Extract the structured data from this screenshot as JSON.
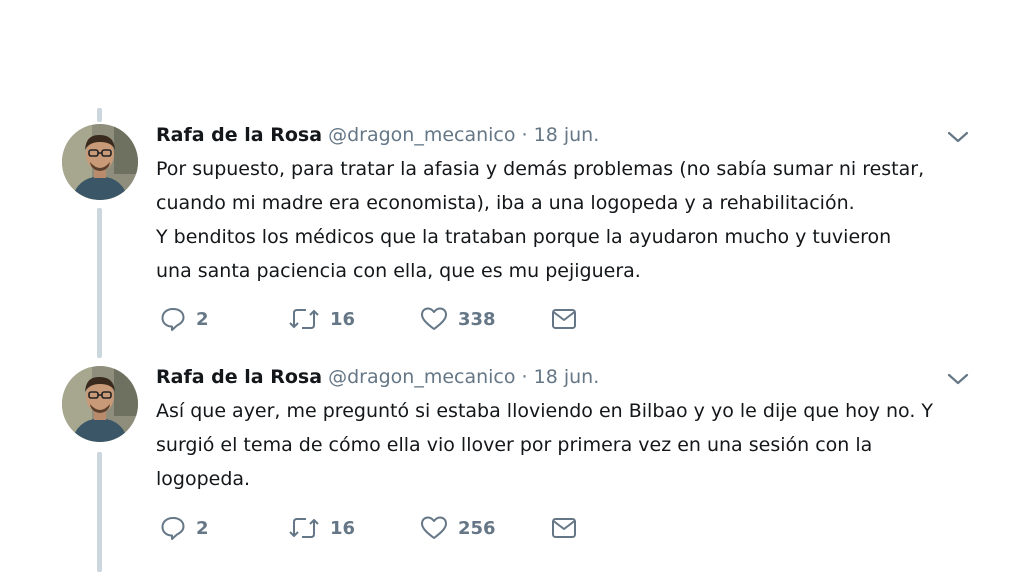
{
  "tweets": [
    {
      "name": "Rafa de la Rosa",
      "handle": "@dragon_mecanico",
      "separator": "·",
      "date": "18 jun.",
      "lines": [
        "Por supuesto, para tratar la afasia y demás problemas (no sabía sumar ni restar,",
        "cuando mi madre era economista), iba a una logopeda y a rehabilitación.",
        "Y benditos los médicos que la trataban porque la ayudaron mucho y tuvieron",
        "una santa paciencia con ella, que es mu pejiguera."
      ],
      "replies": "2",
      "retweets": "16",
      "likes": "338"
    },
    {
      "name": "Rafa de la Rosa",
      "handle": "@dragon_mecanico",
      "separator": "·",
      "date": "18 jun.",
      "lines": [
        "Así que ayer, me preguntó si estaba lloviendo en Bilbao y yo le dije que hoy no. Y",
        "surgió el tema de cómo ella vio llover por primera vez en una sesión con la",
        "logopeda."
      ],
      "replies": "2",
      "retweets": "16",
      "likes": "256"
    }
  ],
  "icons": {
    "reply": "speech-bubble-icon",
    "retweet": "retweet-arrows-icon",
    "like": "heart-icon",
    "message": "envelope-icon",
    "menu": "chevron-down-icon"
  },
  "colors": {
    "text": "#14171a",
    "secondary": "#657786",
    "thread_line": "#ccd6dd"
  }
}
